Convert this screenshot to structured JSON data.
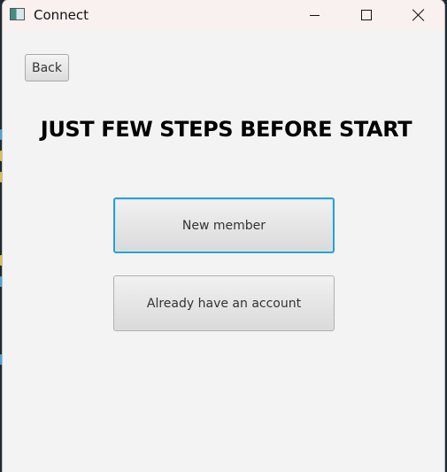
{
  "window": {
    "title": "Connect",
    "icon": "app-window-icon",
    "controls": {
      "minimize": "minimize-icon",
      "maximize": "maximize-icon",
      "close": "close-icon"
    }
  },
  "toolbar": {
    "back_label": "Back"
  },
  "main": {
    "heading": "JUST FEW STEPS BEFORE START",
    "new_member_label": "New member",
    "existing_account_label": "Already have an account"
  },
  "colors": {
    "focus_ring": "#2aa0d4",
    "window_bg": "#f3f3f3",
    "titlebar_bg": "#f9f0f0"
  }
}
